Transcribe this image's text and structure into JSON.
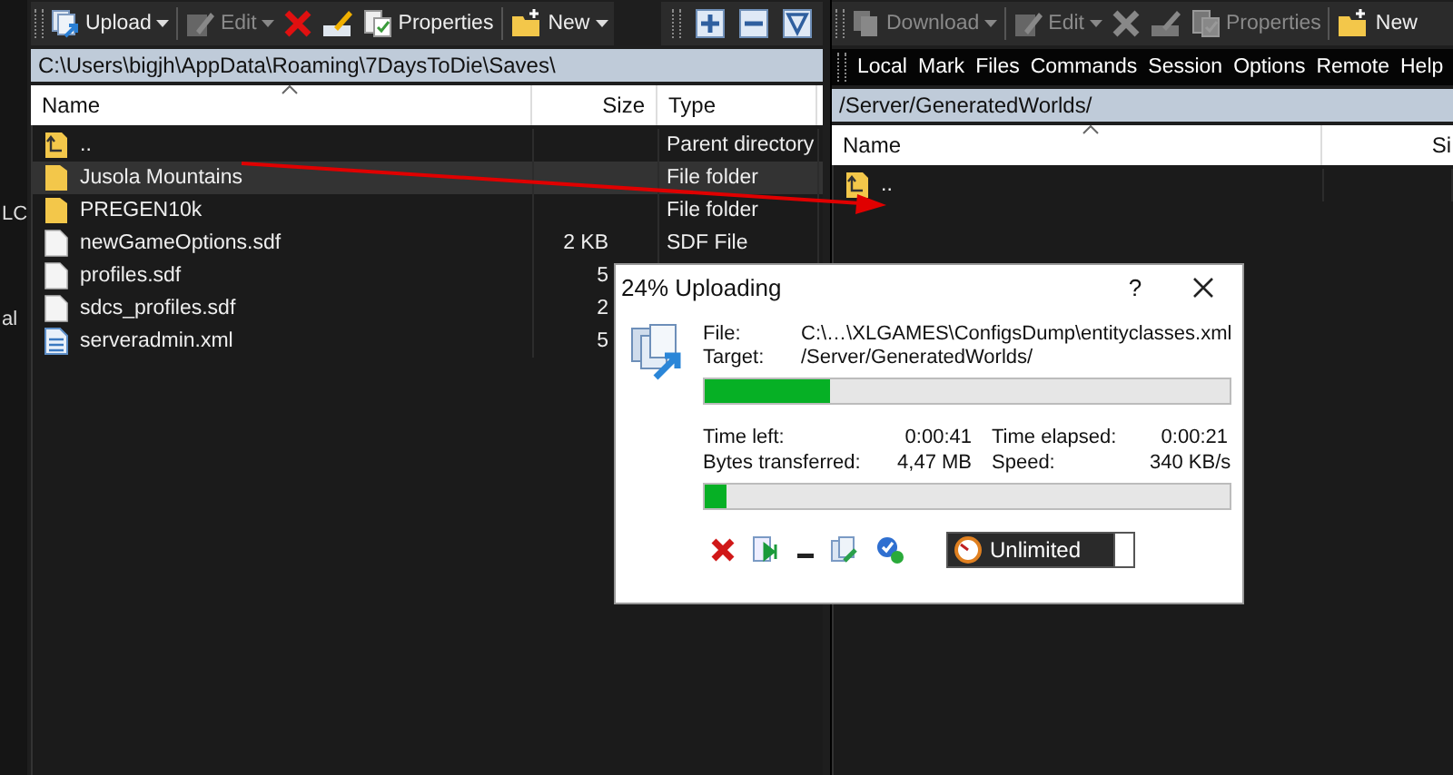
{
  "left_strip": {
    "texts": [
      "LC",
      "al"
    ]
  },
  "local_toolbar": {
    "buttons": [
      {
        "kind": "upload",
        "label": "Upload",
        "disabled": false,
        "dropdown": true
      },
      {
        "kind": "edit",
        "label": "Edit",
        "disabled": true,
        "dropdown": true
      },
      {
        "kind": "delete",
        "disabled": false,
        "dropdown": false
      },
      {
        "kind": "rename",
        "disabled": false,
        "dropdown": false
      },
      {
        "kind": "properties",
        "label": "Properties",
        "disabled": false,
        "dropdown": false
      },
      {
        "kind": "new",
        "label": "New",
        "disabled": false,
        "dropdown": true
      }
    ]
  },
  "selection_toolbar": {
    "buttons": [
      {
        "kind": "plus"
      },
      {
        "kind": "minus"
      },
      {
        "kind": "filter"
      }
    ]
  },
  "local_panel": {
    "path": "C:\\Users\\bigjh\\AppData\\Roaming\\7DaysToDie\\Saves\\",
    "columns": [
      "Name",
      "Size",
      "Type"
    ],
    "rows": [
      {
        "kind": "parent",
        "name": "..",
        "type": "Parent directory",
        "hovered": false
      },
      {
        "kind": "folder",
        "name": "Jusola Mountains",
        "type": "File folder",
        "hovered": true
      },
      {
        "kind": "folder",
        "name": "PREGEN10k",
        "type": "File folder",
        "hovered": false
      },
      {
        "kind": "file",
        "name": "newGameOptions.sdf",
        "size": "2 KB",
        "type": "SDF File",
        "hovered": false
      },
      {
        "kind": "file",
        "name": "profiles.sdf",
        "size": "5",
        "hovered": false
      },
      {
        "kind": "file",
        "name": "sdcs_profiles.sdf",
        "size": "2",
        "hovered": false
      },
      {
        "kind": "xml",
        "name": "serveradmin.xml",
        "size": "5",
        "hovered": false
      }
    ]
  },
  "remote_toolbar": {
    "buttons": [
      {
        "kind": "download",
        "label": "Download",
        "disabled": true,
        "dropdown": true
      },
      {
        "kind": "edit",
        "label": "Edit",
        "disabled": true,
        "dropdown": true
      },
      {
        "kind": "delete",
        "disabled": true,
        "dropdown": false
      },
      {
        "kind": "rename",
        "disabled": true,
        "dropdown": false
      },
      {
        "kind": "properties",
        "label": "Properties",
        "disabled": true,
        "dropdown": false
      },
      {
        "kind": "new",
        "label": "New",
        "disabled": false,
        "dropdown": false
      }
    ]
  },
  "menu": [
    "Local",
    "Mark",
    "Files",
    "Commands",
    "Session",
    "Options",
    "Remote",
    "Help"
  ],
  "remote_panel": {
    "path": "/Server/GeneratedWorlds/",
    "columns": [
      "Name",
      "Si"
    ],
    "rows": [
      {
        "kind": "parent",
        "name": "..",
        "hovered": false
      }
    ]
  },
  "transfer_dialog": {
    "title": "24% Uploading",
    "help": "?",
    "file_label": "File:",
    "file": "C:\\…\\XLGAMES\\ConfigsDump\\entityclasses.xml",
    "target_label": "Target:",
    "target": "/Server/GeneratedWorlds/",
    "file_progress": {
      "level": 0.24
    },
    "stats": [
      {
        "label": "Time left:",
        "value": "0:00:41"
      },
      {
        "label": "Time elapsed:",
        "value": "0:00:21"
      },
      {
        "label": "Bytes transferred:",
        "value": "4,47 MB"
      },
      {
        "label": "Speed:",
        "value": "340 KB/s"
      }
    ],
    "total_progress": {
      "level": 0.04
    },
    "actions": [
      {
        "kind": "cancel"
      },
      {
        "kind": "skip"
      },
      {
        "kind": "minimize"
      },
      {
        "kind": "queue"
      },
      {
        "kind": "done"
      }
    ],
    "speed_limit": {
      "label": "Unlimited"
    }
  }
}
